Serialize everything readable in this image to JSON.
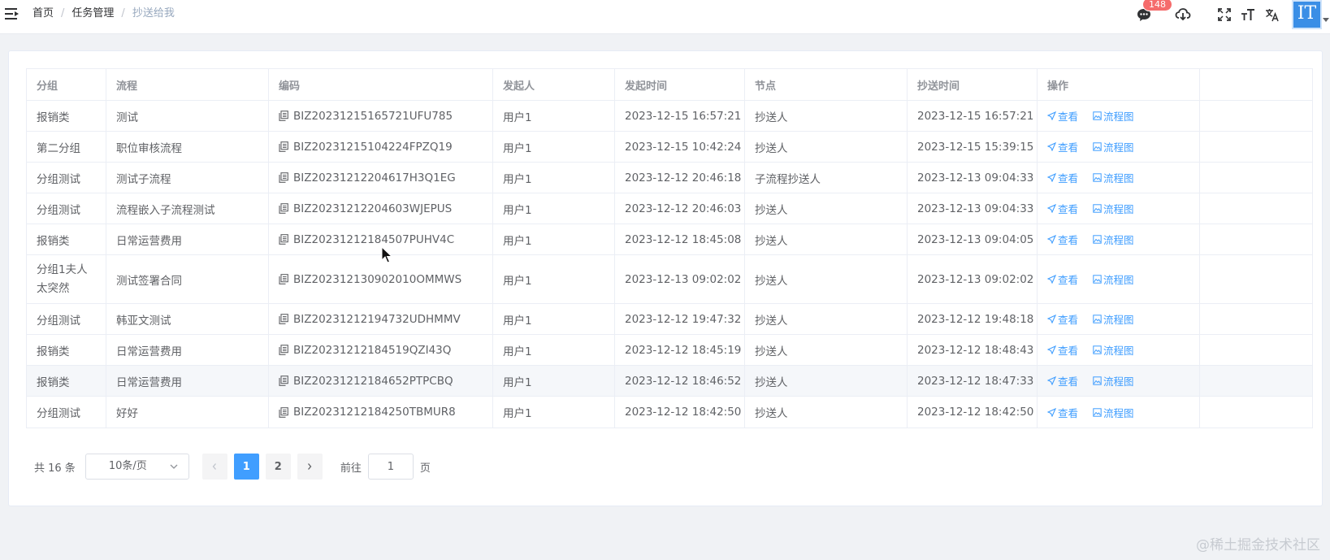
{
  "breadcrumb": {
    "home": "首页",
    "parent": "任务管理",
    "current": "抄送给我",
    "separator": "/"
  },
  "header": {
    "message_count": "148",
    "avatar_text": "IT"
  },
  "table": {
    "headers": [
      "分组",
      "流程",
      "编码",
      "发起人",
      "发起时间",
      "节点",
      "抄送时间",
      "操作"
    ],
    "rows": [
      {
        "group": "报销类",
        "flow": "测试",
        "code": "BIZ20231215165721UFU785",
        "initiator": "用户1",
        "start_time": "2023-12-15 16:57:21",
        "node": "抄送人",
        "cc_time": "2023-12-15 16:57:21"
      },
      {
        "group": "第二分组",
        "flow": "职位审核流程",
        "code": "BIZ20231215104224FPZQ19",
        "initiator": "用户1",
        "start_time": "2023-12-15 10:42:24",
        "node": "抄送人",
        "cc_time": "2023-12-15 15:39:15"
      },
      {
        "group": "分组测试",
        "flow": "测试子流程",
        "code": "BIZ20231212204617H3Q1EG",
        "initiator": "用户1",
        "start_time": "2023-12-12 20:46:18",
        "node": "子流程抄送人",
        "cc_time": "2023-12-13 09:04:33"
      },
      {
        "group": "分组测试",
        "flow": "流程嵌入子流程测试",
        "code": "BIZ20231212204603WJEPUS",
        "initiator": "用户1",
        "start_time": "2023-12-12 20:46:03",
        "node": "抄送人",
        "cc_time": "2023-12-13 09:04:33"
      },
      {
        "group": "报销类",
        "flow": "日常运营费用",
        "code": "BIZ20231212184507PUHV4C",
        "initiator": "用户1",
        "start_time": "2023-12-12 18:45:08",
        "node": "抄送人",
        "cc_time": "2023-12-13 09:04:05"
      },
      {
        "group": "分组1夫人太突然",
        "flow": "测试签署合同",
        "code": "BIZ202312130902010OMMWS",
        "initiator": "用户1",
        "start_time": "2023-12-13 09:02:02",
        "node": "抄送人",
        "cc_time": "2023-12-13 09:02:02"
      },
      {
        "group": "分组测试",
        "flow": "韩亚文测试",
        "code": "BIZ20231212194732UDHMMV",
        "initiator": "用户1",
        "start_time": "2023-12-12 19:47:32",
        "node": "抄送人",
        "cc_time": "2023-12-12 19:48:18"
      },
      {
        "group": "报销类",
        "flow": "日常运营费用",
        "code": "BIZ20231212184519QZI43Q",
        "initiator": "用户1",
        "start_time": "2023-12-12 18:45:19",
        "node": "抄送人",
        "cc_time": "2023-12-12 18:48:43"
      },
      {
        "group": "报销类",
        "flow": "日常运营费用",
        "code": "BIZ20231212184652PTPCBQ",
        "initiator": "用户1",
        "start_time": "2023-12-12 18:46:52",
        "node": "抄送人",
        "cc_time": "2023-12-12 18:47:33"
      },
      {
        "group": "分组测试",
        "flow": "好好",
        "code": "BIZ20231212184250TBMUR8",
        "initiator": "用户1",
        "start_time": "2023-12-12 18:42:50",
        "node": "抄送人",
        "cc_time": "2023-12-12 18:42:50"
      }
    ],
    "actions": {
      "view": "查看",
      "flowchart": "流程图"
    }
  },
  "pagination": {
    "total_text": "共 16 条",
    "page_size": "10条/页",
    "pages": [
      "1",
      "2"
    ],
    "current_page": "1",
    "goto_label": "前往",
    "goto_value": "1",
    "page_suffix": "页"
  },
  "watermark": "@稀土掘金技术社区",
  "colors": {
    "primary": "#409eff",
    "badge": "#f56c6c",
    "avatar_bg": "#3a8ee6"
  }
}
